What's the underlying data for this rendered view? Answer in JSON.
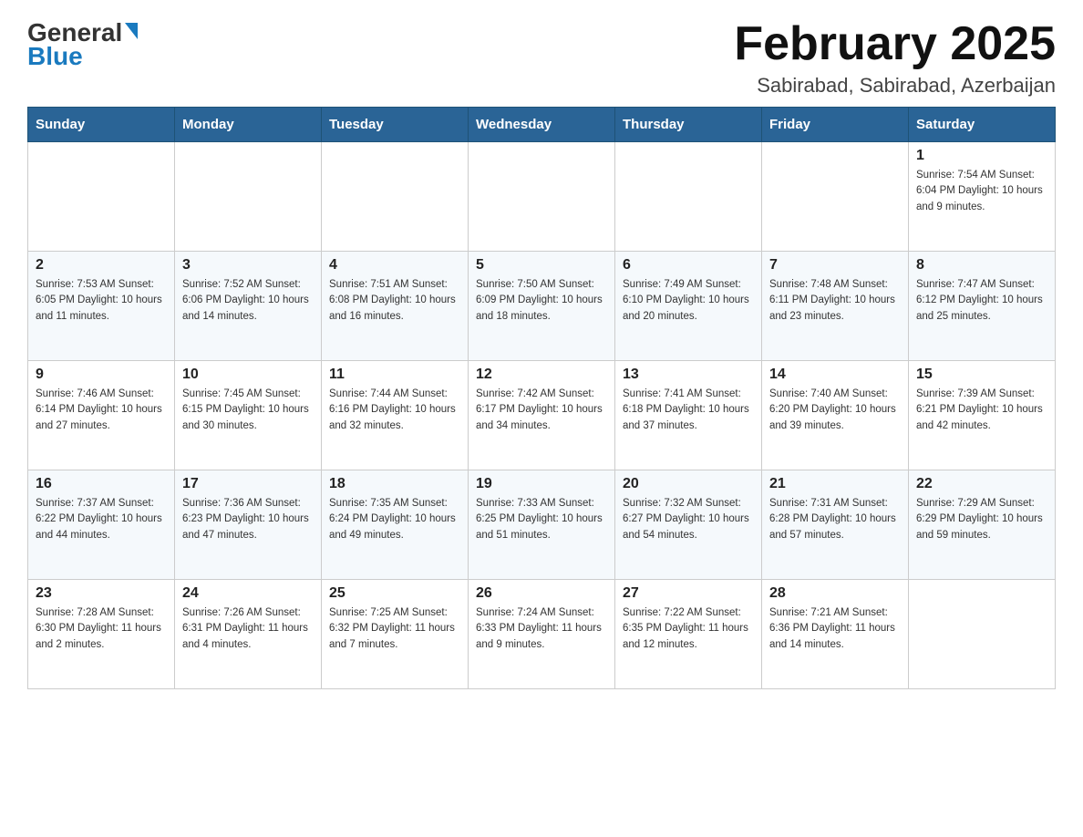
{
  "header": {
    "logo_general": "General",
    "logo_blue": "Blue",
    "month_year": "February 2025",
    "location": "Sabirabad, Sabirabad, Azerbaijan"
  },
  "days_of_week": [
    "Sunday",
    "Monday",
    "Tuesday",
    "Wednesday",
    "Thursday",
    "Friday",
    "Saturday"
  ],
  "weeks": [
    [
      {
        "day": "",
        "info": ""
      },
      {
        "day": "",
        "info": ""
      },
      {
        "day": "",
        "info": ""
      },
      {
        "day": "",
        "info": ""
      },
      {
        "day": "",
        "info": ""
      },
      {
        "day": "",
        "info": ""
      },
      {
        "day": "1",
        "info": "Sunrise: 7:54 AM\nSunset: 6:04 PM\nDaylight: 10 hours and 9 minutes."
      }
    ],
    [
      {
        "day": "2",
        "info": "Sunrise: 7:53 AM\nSunset: 6:05 PM\nDaylight: 10 hours and 11 minutes."
      },
      {
        "day": "3",
        "info": "Sunrise: 7:52 AM\nSunset: 6:06 PM\nDaylight: 10 hours and 14 minutes."
      },
      {
        "day": "4",
        "info": "Sunrise: 7:51 AM\nSunset: 6:08 PM\nDaylight: 10 hours and 16 minutes."
      },
      {
        "day": "5",
        "info": "Sunrise: 7:50 AM\nSunset: 6:09 PM\nDaylight: 10 hours and 18 minutes."
      },
      {
        "day": "6",
        "info": "Sunrise: 7:49 AM\nSunset: 6:10 PM\nDaylight: 10 hours and 20 minutes."
      },
      {
        "day": "7",
        "info": "Sunrise: 7:48 AM\nSunset: 6:11 PM\nDaylight: 10 hours and 23 minutes."
      },
      {
        "day": "8",
        "info": "Sunrise: 7:47 AM\nSunset: 6:12 PM\nDaylight: 10 hours and 25 minutes."
      }
    ],
    [
      {
        "day": "9",
        "info": "Sunrise: 7:46 AM\nSunset: 6:14 PM\nDaylight: 10 hours and 27 minutes."
      },
      {
        "day": "10",
        "info": "Sunrise: 7:45 AM\nSunset: 6:15 PM\nDaylight: 10 hours and 30 minutes."
      },
      {
        "day": "11",
        "info": "Sunrise: 7:44 AM\nSunset: 6:16 PM\nDaylight: 10 hours and 32 minutes."
      },
      {
        "day": "12",
        "info": "Sunrise: 7:42 AM\nSunset: 6:17 PM\nDaylight: 10 hours and 34 minutes."
      },
      {
        "day": "13",
        "info": "Sunrise: 7:41 AM\nSunset: 6:18 PM\nDaylight: 10 hours and 37 minutes."
      },
      {
        "day": "14",
        "info": "Sunrise: 7:40 AM\nSunset: 6:20 PM\nDaylight: 10 hours and 39 minutes."
      },
      {
        "day": "15",
        "info": "Sunrise: 7:39 AM\nSunset: 6:21 PM\nDaylight: 10 hours and 42 minutes."
      }
    ],
    [
      {
        "day": "16",
        "info": "Sunrise: 7:37 AM\nSunset: 6:22 PM\nDaylight: 10 hours and 44 minutes."
      },
      {
        "day": "17",
        "info": "Sunrise: 7:36 AM\nSunset: 6:23 PM\nDaylight: 10 hours and 47 minutes."
      },
      {
        "day": "18",
        "info": "Sunrise: 7:35 AM\nSunset: 6:24 PM\nDaylight: 10 hours and 49 minutes."
      },
      {
        "day": "19",
        "info": "Sunrise: 7:33 AM\nSunset: 6:25 PM\nDaylight: 10 hours and 51 minutes."
      },
      {
        "day": "20",
        "info": "Sunrise: 7:32 AM\nSunset: 6:27 PM\nDaylight: 10 hours and 54 minutes."
      },
      {
        "day": "21",
        "info": "Sunrise: 7:31 AM\nSunset: 6:28 PM\nDaylight: 10 hours and 57 minutes."
      },
      {
        "day": "22",
        "info": "Sunrise: 7:29 AM\nSunset: 6:29 PM\nDaylight: 10 hours and 59 minutes."
      }
    ],
    [
      {
        "day": "23",
        "info": "Sunrise: 7:28 AM\nSunset: 6:30 PM\nDaylight: 11 hours and 2 minutes."
      },
      {
        "day": "24",
        "info": "Sunrise: 7:26 AM\nSunset: 6:31 PM\nDaylight: 11 hours and 4 minutes."
      },
      {
        "day": "25",
        "info": "Sunrise: 7:25 AM\nSunset: 6:32 PM\nDaylight: 11 hours and 7 minutes."
      },
      {
        "day": "26",
        "info": "Sunrise: 7:24 AM\nSunset: 6:33 PM\nDaylight: 11 hours and 9 minutes."
      },
      {
        "day": "27",
        "info": "Sunrise: 7:22 AM\nSunset: 6:35 PM\nDaylight: 11 hours and 12 minutes."
      },
      {
        "day": "28",
        "info": "Sunrise: 7:21 AM\nSunset: 6:36 PM\nDaylight: 11 hours and 14 minutes."
      },
      {
        "day": "",
        "info": ""
      }
    ]
  ]
}
